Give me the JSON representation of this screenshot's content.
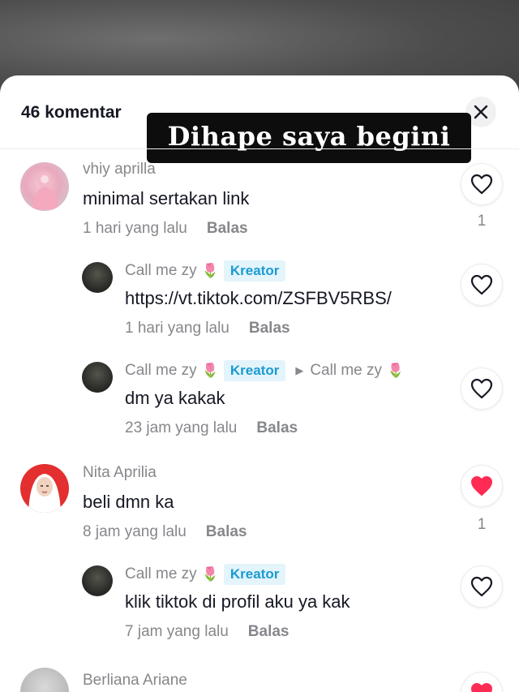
{
  "header": {
    "comment_count": "46 komentar",
    "caption": "Dihape saya begini"
  },
  "comments": [
    {
      "user": "vhiy aprilla",
      "text": "minimal sertakan link",
      "time": "1 hari yang lalu",
      "reply": "Balas",
      "likes": "1",
      "liked": false
    },
    {
      "user": "Call me zy",
      "badge": "Kreator",
      "text": "https://vt.tiktok.com/ZSFBV5RBS/",
      "time": "1 hari yang lalu",
      "reply": "Balas",
      "liked": false
    },
    {
      "user": "Call me zy",
      "badge": "Kreator",
      "reply_to": "Call me zy",
      "text": "dm ya kakak",
      "time": "23 jam yang lalu",
      "reply": "Balas",
      "liked": false
    },
    {
      "user": "Nita Aprilia",
      "text": "beli dmn ka",
      "time": "8 jam yang lalu",
      "reply": "Balas",
      "likes": "1",
      "liked": true
    },
    {
      "user": "Call me zy",
      "badge": "Kreator",
      "text": "klik tiktok di profil aku ya kak",
      "time": "7 jam yang lalu",
      "reply": "Balas",
      "liked": false
    },
    {
      "user": "Berliana Ariane",
      "liked": true
    }
  ],
  "colors": {
    "liked_red": "#fe2c55",
    "badge_text": "#1a9bd1",
    "secondary_text": "#86878b"
  },
  "icons": {
    "close": "close-icon",
    "like": "heart-icon",
    "liked": "heart-filled-icon",
    "tulip": "tulip-icon",
    "reply_arrow": "reply-arrow-icon"
  }
}
